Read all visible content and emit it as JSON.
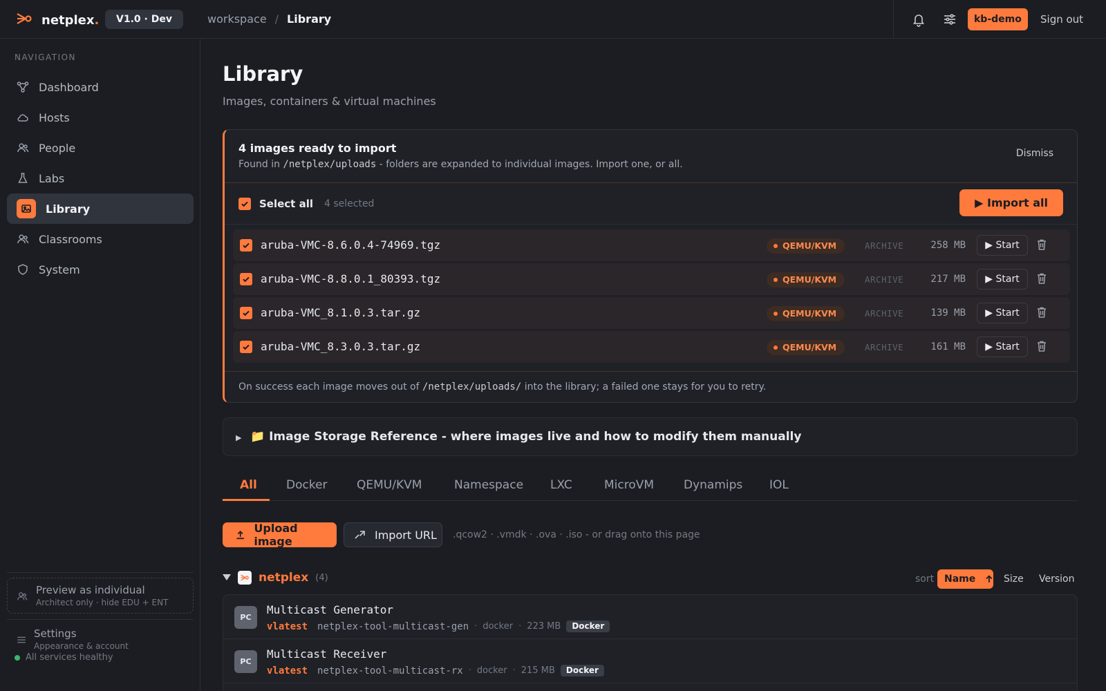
{
  "brand": {
    "name": "netplex",
    "dot": ".",
    "version": "V1.0 · Dev"
  },
  "breadcrumb": {
    "workspace": "workspace",
    "separator": "/",
    "current": "Library"
  },
  "topbar": {
    "user": "kb-demo",
    "sign_out": "Sign out"
  },
  "sidebar": {
    "section_title": "NAVIGATION",
    "items": [
      {
        "label": "Dashboard",
        "icon": "dashboard-icon"
      },
      {
        "label": "Hosts",
        "icon": "cloud-icon"
      },
      {
        "label": "People",
        "icon": "people-icon"
      },
      {
        "label": "Labs",
        "icon": "flask-icon"
      },
      {
        "label": "Library",
        "icon": "image-icon",
        "active": true
      },
      {
        "label": "Classrooms",
        "icon": "people-icon"
      },
      {
        "label": "System",
        "icon": "shield-icon"
      }
    ],
    "preview": {
      "title": "Preview as individual",
      "subtitle": "Architect only · hide EDU + ENT"
    },
    "settings": {
      "title": "Settings",
      "subtitle": "Appearance & account"
    },
    "health": "All services healthy"
  },
  "page": {
    "title": "Library",
    "subtitle": "Images, containers & virtual machines"
  },
  "import": {
    "title": "4 images ready to import",
    "desc_before": "Found in ",
    "desc_path": "/netplex/uploads",
    "desc_after": " - folders are expanded to individual images. Import one, or all.",
    "dismiss": "Dismiss",
    "select_all": "Select all",
    "selected_count": "4 selected",
    "import_all": "▶ Import all",
    "files": [
      {
        "name": "aruba-VMC-8.6.0.4-74969.tgz",
        "type": "QEMU/KVM",
        "kind": "ARCHIVE",
        "size": "258 MB",
        "action": "▶ Start"
      },
      {
        "name": "aruba-VMC-8.8.0.1_80393.tgz",
        "type": "QEMU/KVM",
        "kind": "ARCHIVE",
        "size": "217 MB",
        "action": "▶ Start"
      },
      {
        "name": "aruba-VMC_8.1.0.3.tar.gz",
        "type": "QEMU/KVM",
        "kind": "ARCHIVE",
        "size": "139 MB",
        "action": "▶ Start"
      },
      {
        "name": "aruba-VMC_8.3.0.3.tar.gz",
        "type": "QEMU/KVM",
        "kind": "ARCHIVE",
        "size": "161 MB",
        "action": "▶ Start"
      }
    ],
    "footer_before": "On success each image moves out of ",
    "footer_path": "/netplex/uploads/",
    "footer_after": " into the library; a failed one stays for you to retry."
  },
  "storage_ref": {
    "label": "📁 Image Storage Reference - where images live and how to modify them manually"
  },
  "tabs": [
    "All",
    "Docker",
    "QEMU/KVM",
    "Namespace",
    "LXC",
    "MicroVM",
    "Dynamips",
    "IOL"
  ],
  "upload": {
    "upload_label": "Upload image",
    "import_url_label": "Import URL",
    "hint": ".qcow2 · .vmdk · .ova · .iso - or drag onto this page"
  },
  "group": {
    "name": "netplex",
    "count": "(4)",
    "sort_label": "sort",
    "sort_name": "Name",
    "sort_size": "Size",
    "sort_version": "Version"
  },
  "images": [
    {
      "avatar": "PC",
      "name": "Multicast Generator",
      "version": "vlatest",
      "repo": "netplex-tool-multicast-gen",
      "runtime": "docker",
      "size": "223 MB",
      "badge": "Docker"
    },
    {
      "avatar": "PC",
      "name": "Multicast Receiver",
      "version": "vlatest",
      "repo": "netplex-tool-multicast-rx",
      "runtime": "docker",
      "size": "215 MB",
      "badge": "Docker"
    }
  ],
  "colors": {
    "accent": "#ff7a3d",
    "background": "#1b1d22",
    "healthy": "#3fb56b"
  }
}
